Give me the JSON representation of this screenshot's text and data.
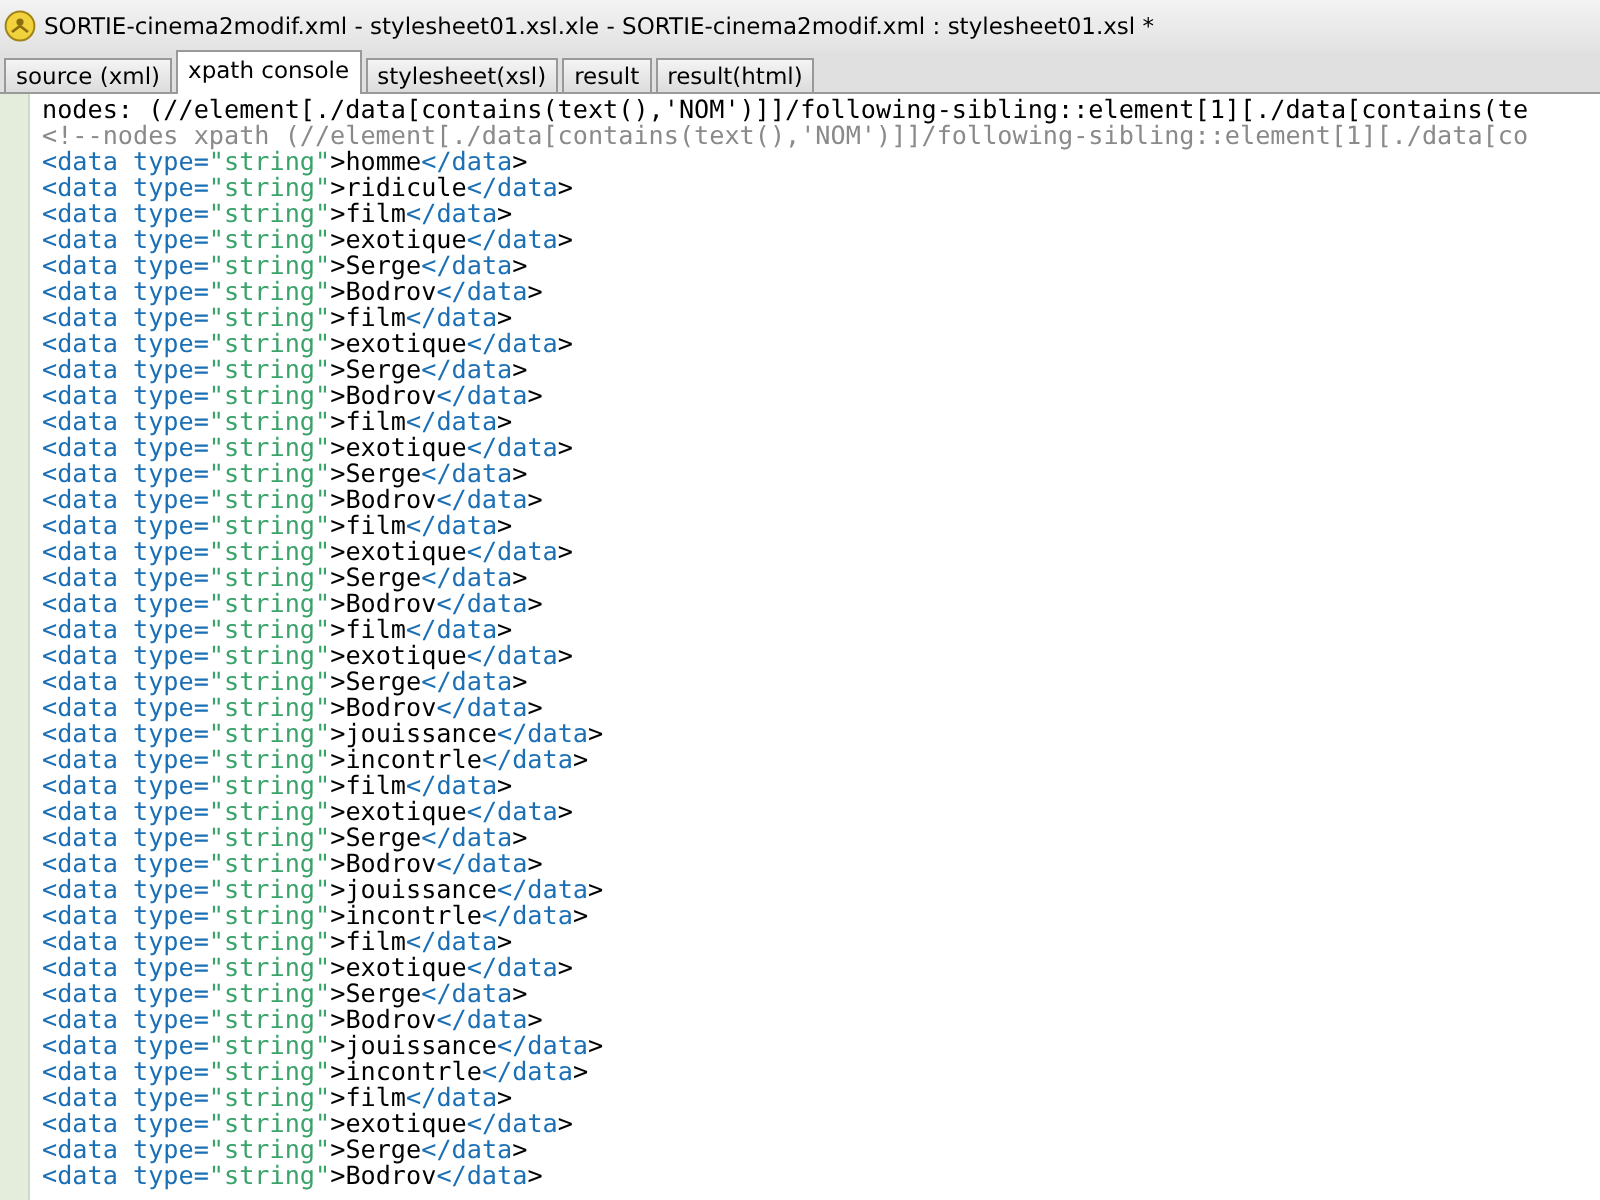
{
  "window": {
    "title": "SORTIE-cinema2modif.xml - stylesheet01.xsl.xle - SORTIE-cinema2modif.xml : stylesheet01.xsl *"
  },
  "tabs": [
    {
      "label": "source (xml)",
      "selected": false
    },
    {
      "label": "xpath console",
      "selected": true
    },
    {
      "label": "stylesheet(xsl)",
      "selected": false
    },
    {
      "label": "result",
      "selected": false
    },
    {
      "label": "result(html)",
      "selected": false
    }
  ],
  "console": {
    "lines": [
      {
        "kind": "query",
        "text": "nodes: (//element[./data[contains(text(),'NOM')]]/following-sibling::element[1][./data[contains(te"
      },
      {
        "kind": "comment",
        "text": "<!--nodes xpath (//element[./data[contains(text(),'NOM')]]/following-sibling::element[1][./data[co"
      },
      {
        "kind": "xml",
        "text": "<data type=\"string\">homme</data>"
      },
      {
        "kind": "xml",
        "text": "<data type=\"string\">ridicule</data>"
      },
      {
        "kind": "xml",
        "text": "<data type=\"string\">film</data>"
      },
      {
        "kind": "xml",
        "text": "<data type=\"string\">exotique</data>"
      },
      {
        "kind": "xml",
        "text": "<data type=\"string\">Serge</data>"
      },
      {
        "kind": "xml",
        "text": "<data type=\"string\">Bodrov</data>"
      },
      {
        "kind": "xml",
        "text": "<data type=\"string\">film</data>"
      },
      {
        "kind": "xml",
        "text": "<data type=\"string\">exotique</data>"
      },
      {
        "kind": "xml",
        "text": "<data type=\"string\">Serge</data>"
      },
      {
        "kind": "xml",
        "text": "<data type=\"string\">Bodrov</data>"
      },
      {
        "kind": "xml",
        "text": "<data type=\"string\">film</data>"
      },
      {
        "kind": "xml",
        "text": "<data type=\"string\">exotique</data>"
      },
      {
        "kind": "xml",
        "text": "<data type=\"string\">Serge</data>"
      },
      {
        "kind": "xml",
        "text": "<data type=\"string\">Bodrov</data>"
      },
      {
        "kind": "xml",
        "text": "<data type=\"string\">film</data>"
      },
      {
        "kind": "xml",
        "text": "<data type=\"string\">exotique</data>"
      },
      {
        "kind": "xml",
        "text": "<data type=\"string\">Serge</data>"
      },
      {
        "kind": "xml",
        "text": "<data type=\"string\">Bodrov</data>"
      },
      {
        "kind": "xml",
        "text": "<data type=\"string\">film</data>"
      },
      {
        "kind": "xml",
        "text": "<data type=\"string\">exotique</data>"
      },
      {
        "kind": "xml",
        "text": "<data type=\"string\">Serge</data>"
      },
      {
        "kind": "xml",
        "text": "<data type=\"string\">Bodrov</data>"
      },
      {
        "kind": "xml",
        "text": "<data type=\"string\">jouissance</data>"
      },
      {
        "kind": "xml",
        "text": "<data type=\"string\">incontrle</data>"
      },
      {
        "kind": "xml",
        "text": "<data type=\"string\">film</data>"
      },
      {
        "kind": "xml",
        "text": "<data type=\"string\">exotique</data>"
      },
      {
        "kind": "xml",
        "text": "<data type=\"string\">Serge</data>"
      },
      {
        "kind": "xml",
        "text": "<data type=\"string\">Bodrov</data>"
      },
      {
        "kind": "xml",
        "text": "<data type=\"string\">jouissance</data>"
      },
      {
        "kind": "xml",
        "text": "<data type=\"string\">incontrle</data>"
      },
      {
        "kind": "xml",
        "text": "<data type=\"string\">film</data>"
      },
      {
        "kind": "xml",
        "text": "<data type=\"string\">exotique</data>"
      },
      {
        "kind": "xml",
        "text": "<data type=\"string\">Serge</data>"
      },
      {
        "kind": "xml",
        "text": "<data type=\"string\">Bodrov</data>"
      },
      {
        "kind": "xml",
        "text": "<data type=\"string\">jouissance</data>"
      },
      {
        "kind": "xml",
        "text": "<data type=\"string\">incontrle</data>"
      },
      {
        "kind": "xml",
        "text": "<data type=\"string\">film</data>"
      },
      {
        "kind": "xml",
        "text": "<data type=\"string\">exotique</data>"
      },
      {
        "kind": "xml",
        "text": "<data type=\"string\">Serge</data>"
      },
      {
        "kind": "xml",
        "text": "<data type=\"string\">Bodrov</data>"
      }
    ]
  }
}
